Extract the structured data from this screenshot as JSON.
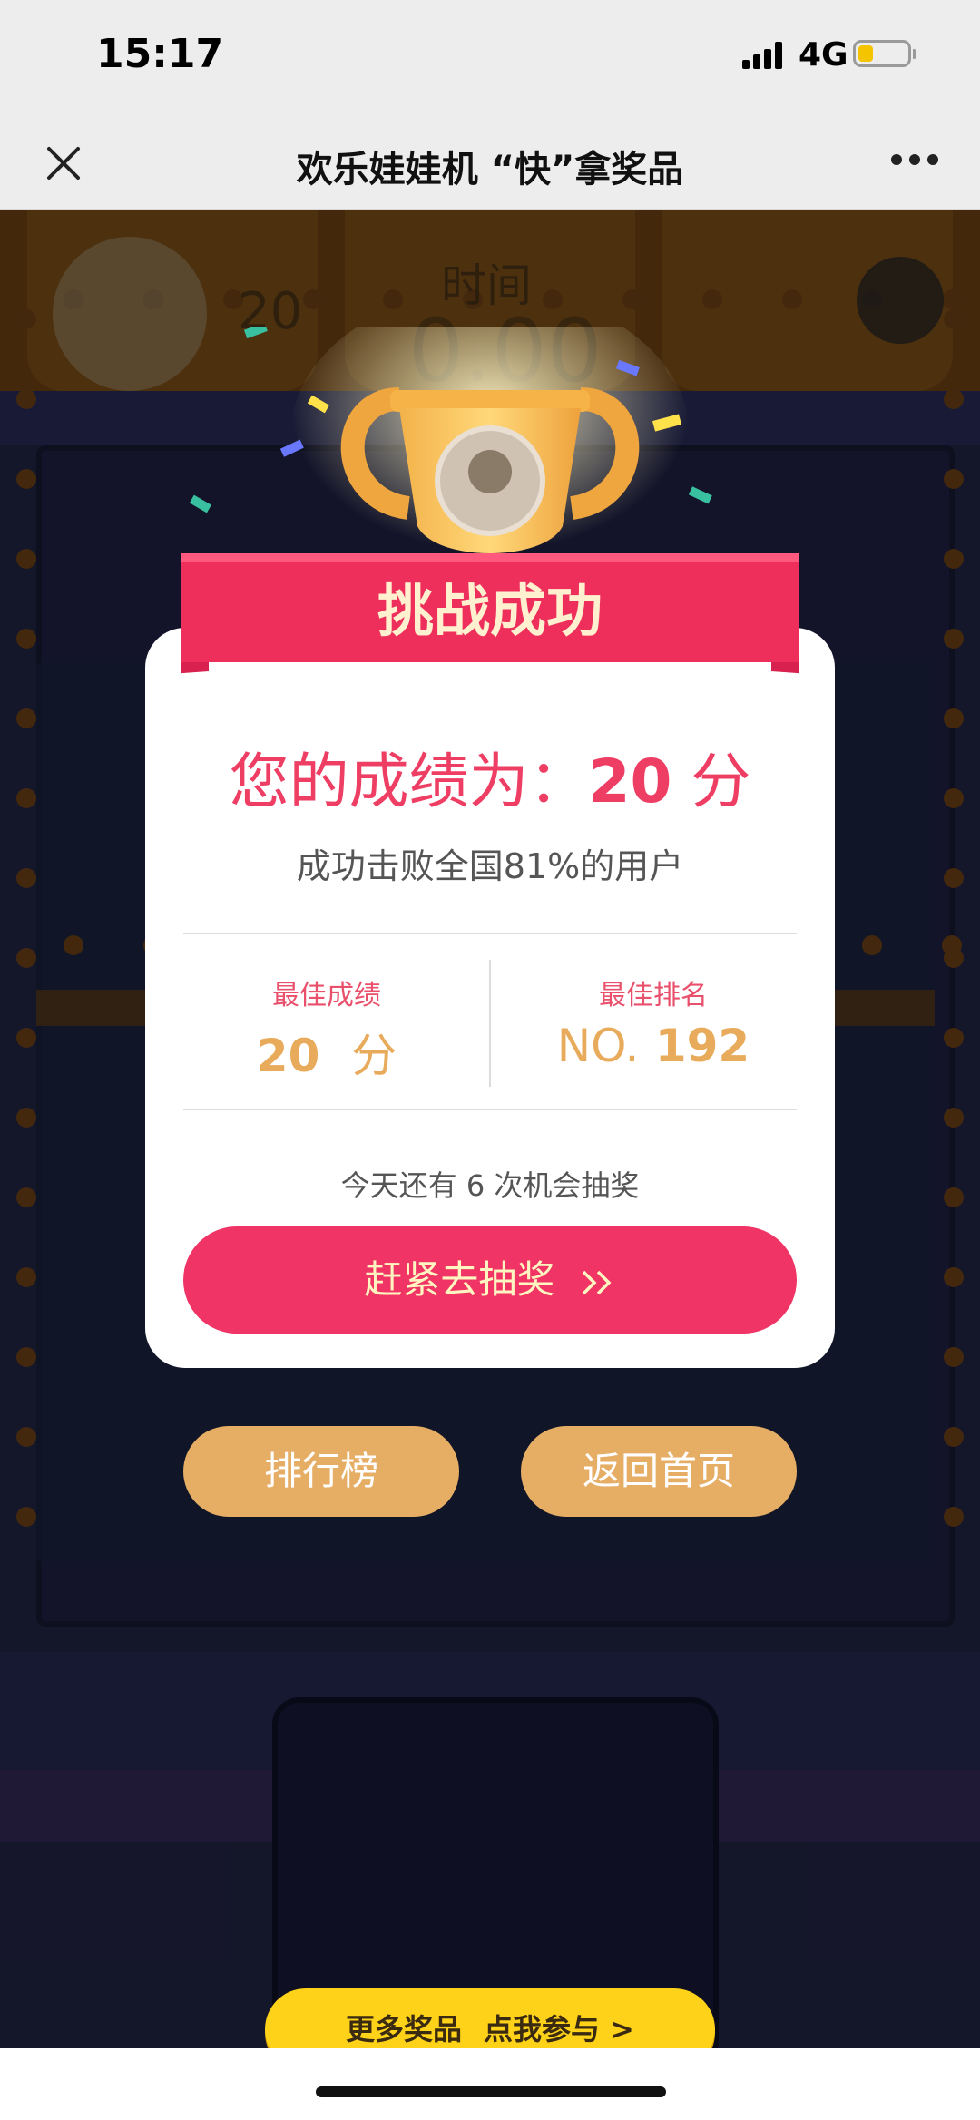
{
  "status_bar": {
    "time": "15:17",
    "network": "4G",
    "battery_level": 0.25
  },
  "nav": {
    "title": "欢乐娃娃机 “快”拿奖品",
    "close_icon": "close-icon",
    "more_icon": "more-dots-icon"
  },
  "hud": {
    "score": "20",
    "time_label": "时间",
    "timer": "0.00",
    "sound_icon": "sound-icon"
  },
  "result": {
    "banner_title": "挑战成功",
    "score_prefix": "您的成绩为：",
    "score_value": "20",
    "score_unit": "分",
    "beat_text": "成功击败全国81%的用户",
    "best_score_label": "最佳成绩",
    "best_score_value": "20",
    "best_score_unit": "分",
    "best_rank_label": "最佳排名",
    "best_rank_prefix": "NO.",
    "best_rank_value": "192",
    "chance_text": "今天还有 6 次机会抽奖",
    "draw_button": "赶紧去抽奖"
  },
  "buttons": {
    "leaderboard": "排行榜",
    "home": "返回首页"
  },
  "banner": {
    "more_prizes": "更多奖品",
    "join": "点我参与 >"
  },
  "colors": {
    "accent": "#F03466",
    "gold": "#E6AD65",
    "yellow": "#FFD21A"
  }
}
